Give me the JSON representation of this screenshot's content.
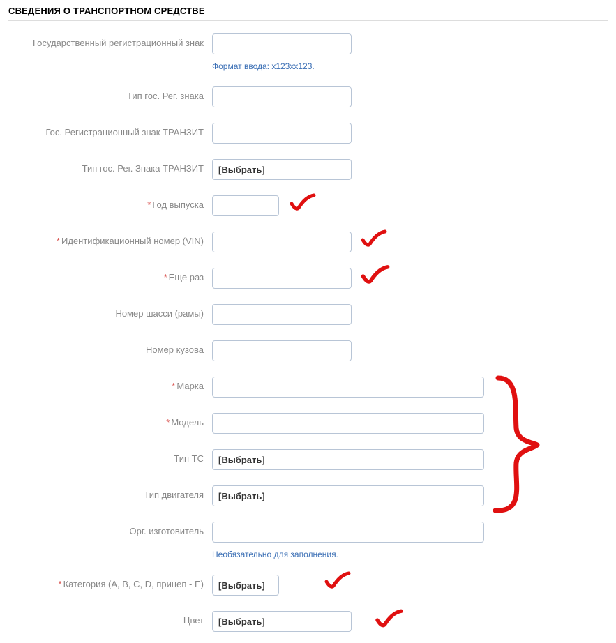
{
  "section_title": "СВЕДЕНИЯ О ТРАНСПОРТНОМ СРЕДСТВЕ",
  "select_placeholder": "[Выбрать]",
  "fields": {
    "reg_plate": {
      "label": "Государственный регистрационный знак",
      "hint": "Формат ввода: x123xx123."
    },
    "reg_plate_type": {
      "label": "Тип гос. Рег. знака"
    },
    "transit_plate": {
      "label": "Гос. Регистрационный знак ТРАНЗИТ"
    },
    "transit_plate_type": {
      "label": "Тип гос. Рег. Знака ТРАНЗИТ"
    },
    "year": {
      "label": "Год выпуска",
      "required": true
    },
    "vin": {
      "label": "Идентификационный номер (VIN)",
      "required": true
    },
    "vin_repeat": {
      "label": "Еще раз",
      "required": true
    },
    "chassis": {
      "label": "Номер шасси (рамы)"
    },
    "body_no": {
      "label": "Номер кузова"
    },
    "make": {
      "label": "Марка",
      "required": true
    },
    "model": {
      "label": "Модель",
      "required": true
    },
    "vehicle_type": {
      "label": "Тип ТС"
    },
    "engine_type": {
      "label": "Тип двигателя"
    },
    "manufacturer": {
      "label": "Орг. изготовитель",
      "hint": "Необязательно для заполнения."
    },
    "category": {
      "label": "Категория (A, B, C, D, прицеп - E)",
      "required": true
    },
    "color": {
      "label": "Цвет"
    }
  }
}
